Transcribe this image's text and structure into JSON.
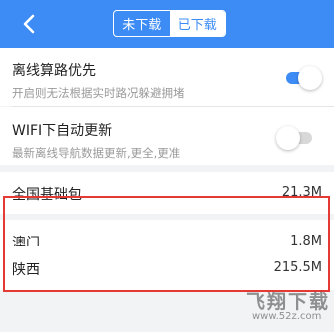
{
  "header": {
    "tabs": [
      {
        "label": "未下载",
        "active": false
      },
      {
        "label": "已下载",
        "active": true
      }
    ],
    "background": "#3d8cf5"
  },
  "settings": [
    {
      "title": "离线算路优先",
      "description": "开启则无法根据实时路况躲避拥堵",
      "toggle": "on"
    },
    {
      "title": "WIFI下自动更新",
      "description": "最新离线导航数据更新,更全,更准",
      "toggle": "off"
    }
  ],
  "packages": [
    {
      "name": "全国基础包",
      "size": "21.3M"
    },
    {
      "name": "澳门",
      "size": "1.8M"
    },
    {
      "name": "陕西",
      "size": "215.5M"
    }
  ],
  "watermark": {
    "text": "飞翔下载",
    "url": "www.52z.com"
  },
  "colors": {
    "accent": "#3d8cf5",
    "highlight": "#e53935"
  }
}
